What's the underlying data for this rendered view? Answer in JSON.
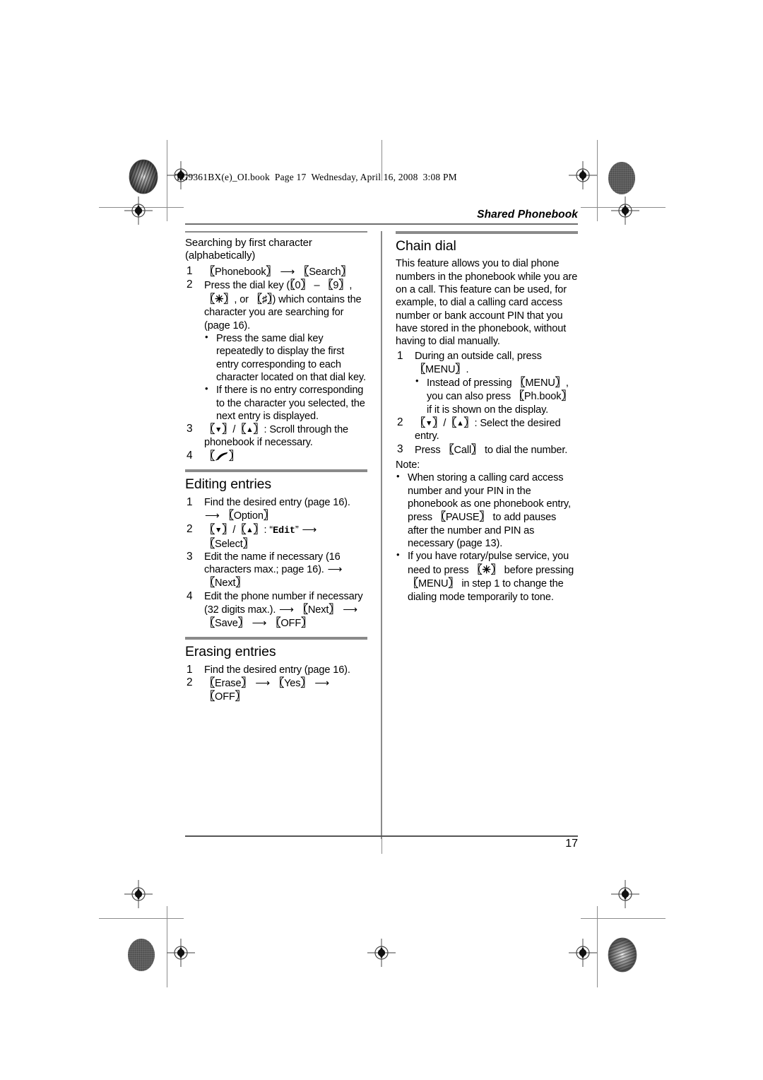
{
  "print_slug": {
    "filename": "TG9361BX(e)_OI.book",
    "page": "Page 17",
    "weekday": "Wednesday, April 16, 2008",
    "time": "3:08 PM"
  },
  "running_head": "Shared Phonebook",
  "folio": "17",
  "left_column": {
    "searching": {
      "heading": "Searching by first character (alphabetically)",
      "steps": [
        {
          "num": "1",
          "parts": [
            "key:Phonebook",
            "arrow",
            "key:Search"
          ]
        },
        {
          "num": "2",
          "text_lead": "Press the dial key (",
          "keys_inline": "[0] – [9], [✶], or [♯]",
          "text_tail": ") which contains the character you are searching for (page 16).",
          "bullets": [
            "Press the same dial key repeatedly to display the first entry corresponding to each character located on that dial key.",
            "If there is no entry corresponding to the character you selected, the next entry is displayed."
          ]
        },
        {
          "num": "3",
          "keys": "[▼]/[▲]",
          "text": ": Scroll through the phonebook if necessary."
        },
        {
          "num": "4",
          "icon": "handset-key"
        }
      ]
    },
    "editing": {
      "heading": "Editing entries",
      "steps": [
        {
          "num": "1",
          "text": "Find the desired entry (page 16).",
          "tail_arrow_key": "Option"
        },
        {
          "num": "2",
          "keys": "[▼]/[▲]",
          "quoted_mono": "Edit",
          "arrow_key": "Select"
        },
        {
          "num": "3",
          "text": "Edit the name if necessary (16 characters max.; page 16).",
          "tail_arrow_key": "Next"
        },
        {
          "num": "4",
          "text": "Edit the phone number if necessary (32 digits max.).",
          "tail_keys": [
            "Next",
            "Save",
            "OFF"
          ]
        }
      ]
    },
    "erasing": {
      "heading": "Erasing entries",
      "steps": [
        {
          "num": "1",
          "text": "Find the desired entry (page 16)."
        },
        {
          "num": "2",
          "keys_seq": [
            "Erase",
            "Yes",
            "OFF"
          ]
        }
      ]
    }
  },
  "right_column": {
    "chain_dial": {
      "heading": "Chain dial",
      "intro": "This feature allows you to dial phone numbers in the phonebook while you are on a call. This feature can be used, for example, to dial a calling card access number or bank account PIN that you have stored in the phonebook, without having to dial manually.",
      "steps": [
        {
          "num": "1",
          "text_lead": "During an outside call, press",
          "key": "MENU",
          "text_tail": ".",
          "bullets_rich": [
            {
              "lead": "Instead of pressing ",
              "key1": "MENU",
              "mid": ", you can also press ",
              "key2": "Ph.book",
              "tail": " if it is shown on the display."
            }
          ]
        },
        {
          "num": "2",
          "keys": "[▼]/[▲]",
          "text": ": Select the desired entry."
        },
        {
          "num": "3",
          "text_lead": "Press ",
          "key": "Call",
          "text_tail": " to dial the number."
        }
      ],
      "note_label": "Note:",
      "notes": [
        {
          "lead": "When storing a calling card access number and your PIN in the phonebook as one phonebook entry, press ",
          "key": "PAUSE",
          "tail": " to add pauses after the number and PIN as necessary (page 13)."
        },
        {
          "lead": "If you have rotary/pulse service, you need to press ",
          "key": "✶",
          "mid": " before pressing ",
          "key2": "MENU",
          "tail": " in step 1 to change the dialing mode temporarily to tone."
        }
      ]
    }
  },
  "colors": {
    "rule_gray": "#8a8a8a",
    "head_rule_gray": "#6e6e6e",
    "text": "#000000"
  }
}
